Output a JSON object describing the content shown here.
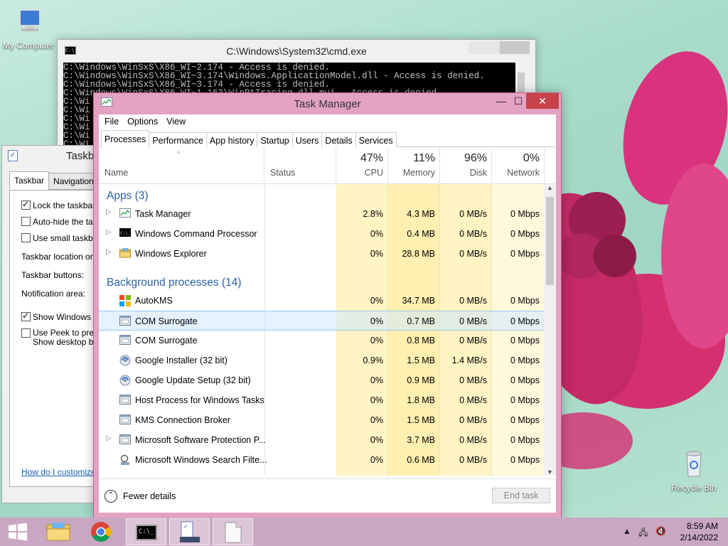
{
  "desktop": {
    "icons": [
      {
        "label": "My Computer"
      },
      {
        "label": "Recycle Bin"
      }
    ]
  },
  "cmd": {
    "title": "C:\\Windows\\System32\\cmd.exe",
    "lines": [
      "C:\\Windows\\WinSxS\\X86_WI~2.174 - Access is denied.",
      "C:\\Windows\\WinSxS\\X86_WI~3.174\\Windows.ApplicationModel.dll - Access is denied.",
      "C:\\Windows\\WinSxS\\X86_WI~3.174 - Access is denied.",
      "C:\\Windows\\WinSxS\\X86_WI~1.163\\WinRtTracing.dll.mui - Access is denied.",
      "C:\\Wi",
      "C:\\Wi",
      "C:\\Wi",
      "C:\\Wi",
      "C:\\Wi",
      "C:\\Wi"
    ]
  },
  "props": {
    "title": "Taskb",
    "tabs": [
      "Taskbar",
      "Navigation"
    ],
    "lock": "Lock the taskbar",
    "autohide": "Auto-hide the task",
    "small": "Use small taskbar",
    "location": "Taskbar location on s",
    "buttons": "Taskbar buttons:",
    "notif": "Notification area:",
    "showwin": "Show Windows St",
    "peek1": "Use Peek to previ",
    "peek2": "Show desktop but",
    "link": "How do I customize t"
  },
  "taskmanager": {
    "title": "Task Manager",
    "menu": [
      "File",
      "Options",
      "View"
    ],
    "tabs": [
      "Processes",
      "Performance",
      "App history",
      "Startup",
      "Users",
      "Details",
      "Services"
    ],
    "columns": {
      "name": "Name",
      "status": "Status",
      "cpu": {
        "pct": "47%",
        "label": "CPU"
      },
      "memory": {
        "pct": "11%",
        "label": "Memory"
      },
      "disk": {
        "pct": "96%",
        "label": "Disk"
      },
      "network": {
        "pct": "0%",
        "label": "Network"
      }
    },
    "groups": {
      "apps": "Apps (3)",
      "background": "Background processes (14)"
    },
    "rows": [
      {
        "name": "Task Manager",
        "cpu": "2.8%",
        "mem": "4.3 MB",
        "disk": "0 MB/s",
        "net": "0 Mbps",
        "icon": "task-manager-icon"
      },
      {
        "name": "Windows Command Processor",
        "cpu": "0%",
        "mem": "0.4 MB",
        "disk": "0 MB/s",
        "net": "0 Mbps",
        "icon": "cmd-icon"
      },
      {
        "name": "Windows Explorer",
        "cpu": "0%",
        "mem": "28.8 MB",
        "disk": "0 MB/s",
        "net": "0 Mbps",
        "icon": "folder-icon"
      },
      {
        "name": "AutoKMS",
        "cpu": "0%",
        "mem": "34.7 MB",
        "disk": "0 MB/s",
        "net": "0 Mbps",
        "icon": "office-icon"
      },
      {
        "name": "COM Surrogate",
        "cpu": "0%",
        "mem": "0.7 MB",
        "disk": "0 MB/s",
        "net": "0 Mbps",
        "icon": "process-icon"
      },
      {
        "name": "COM Surrogate",
        "cpu": "0%",
        "mem": "0.8 MB",
        "disk": "0 MB/s",
        "net": "0 Mbps",
        "icon": "process-icon"
      },
      {
        "name": "Google Installer (32 bit)",
        "cpu": "0.9%",
        "mem": "1.5 MB",
        "disk": "1.4 MB/s",
        "net": "0 Mbps",
        "icon": "google-update-icon"
      },
      {
        "name": "Google Update Setup (32 bit)",
        "cpu": "0%",
        "mem": "0.9 MB",
        "disk": "0 MB/s",
        "net": "0 Mbps",
        "icon": "google-update-icon"
      },
      {
        "name": "Host Process for Windows Tasks",
        "cpu": "0%",
        "mem": "1.8 MB",
        "disk": "0 MB/s",
        "net": "0 Mbps",
        "icon": "process-icon"
      },
      {
        "name": "KMS Connection Broker",
        "cpu": "0%",
        "mem": "1.5 MB",
        "disk": "0 MB/s",
        "net": "0 Mbps",
        "icon": "process-icon"
      },
      {
        "name": "Microsoft Software Protection P...",
        "cpu": "0%",
        "mem": "3.7 MB",
        "disk": "0 MB/s",
        "net": "0 Mbps",
        "icon": "process-icon"
      },
      {
        "name": "Microsoft Windows Search Filte...",
        "cpu": "0%",
        "mem": "0.6 MB",
        "disk": "0 MB/s",
        "net": "0 Mbps",
        "icon": "search-process-icon"
      }
    ],
    "fewer": "Fewer details",
    "endtask": "End task"
  },
  "taskbar": {
    "time": "8:59 AM",
    "date": "2/14/2022"
  }
}
